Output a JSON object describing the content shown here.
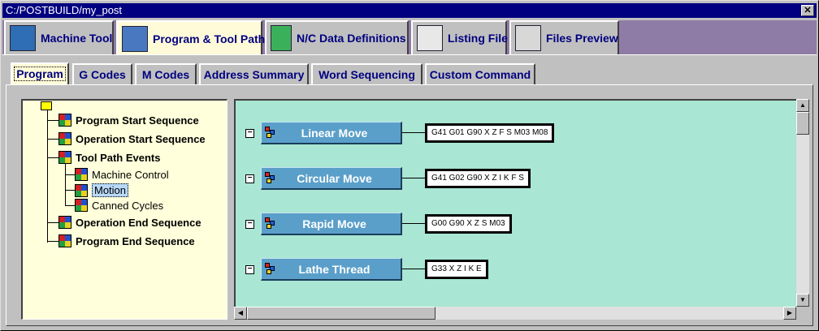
{
  "window": {
    "title": "C:/POSTBUILD/my_post",
    "close_glyph": "✕"
  },
  "top_tabs": [
    {
      "label": "Machine Tool",
      "icon": "machine-tool-icon"
    },
    {
      "label": "Program & Tool Path",
      "icon": "tool-path-icon",
      "active": true
    },
    {
      "label": "N/C Data Definitions",
      "icon": "nc-data-icon"
    },
    {
      "label": "Listing File",
      "icon": "listing-file-icon"
    },
    {
      "label": "Files Preview",
      "icon": "printer-icon"
    }
  ],
  "sub_tabs": [
    {
      "label": "Program",
      "active": true
    },
    {
      "label": "G Codes"
    },
    {
      "label": "M Codes"
    },
    {
      "label": "Address Summary"
    },
    {
      "label": "Word Sequencing"
    },
    {
      "label": "Custom Command"
    }
  ],
  "tree": {
    "items": [
      {
        "label": "Program Start Sequence",
        "bold": true
      },
      {
        "label": "Operation Start Sequence",
        "bold": true
      },
      {
        "label": "Tool Path Events",
        "bold": true
      },
      {
        "label": "Machine Control",
        "bold": false
      },
      {
        "label": "Motion",
        "bold": false,
        "selected": true
      },
      {
        "label": "Canned Cycles",
        "bold": false
      },
      {
        "label": "Operation End Sequence",
        "bold": true
      },
      {
        "label": "Program End Sequence",
        "bold": true
      }
    ]
  },
  "events": [
    {
      "label": "Linear Move",
      "codes": "G41 G01 G90 X Z F S M03 M08"
    },
    {
      "label": "Circular Move",
      "codes": "G41 G02 G90 X Z I K F S"
    },
    {
      "label": "Rapid Move",
      "codes": "G00 G90 X Z S M03"
    },
    {
      "label": "Lathe Thread",
      "codes": "G33 X Z I K E"
    }
  ],
  "colors": {
    "title_bar": "#000080",
    "tab_strip": "#8f7ca6",
    "active_tab": "#fffbd8",
    "canvas": "#a9e6d4",
    "event_button": "#5a9fc9"
  }
}
